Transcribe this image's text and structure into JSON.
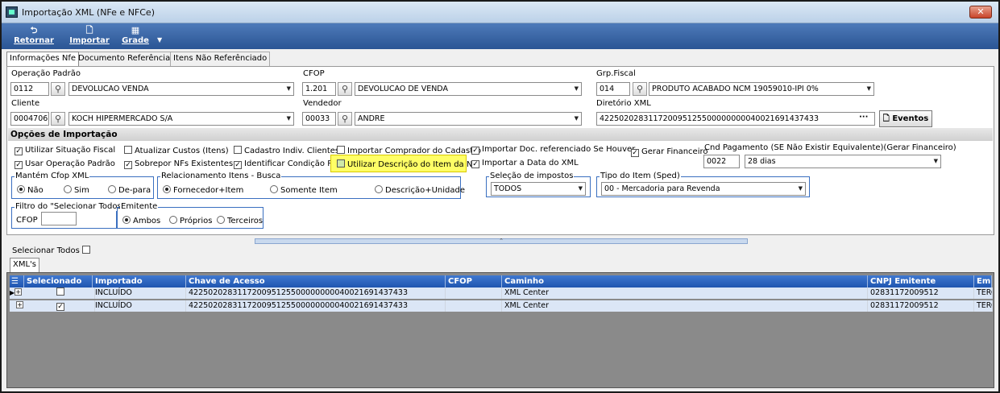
{
  "window": {
    "title": "Importação XML (NFe e NFCe)",
    "close": "✕"
  },
  "toolbar": {
    "retornar": "Retornar",
    "importar": "Importar",
    "grade": "Grade"
  },
  "tabs": [
    "Informações Nfe",
    "Documento Referênciado",
    "Itens Não Referênciado"
  ],
  "form": {
    "operacao_label": "Operação Padrão",
    "operacao_code": "0112",
    "operacao_desc": "DEVOLUCAO VENDA",
    "cfop_label": "CFOP",
    "cfop_code": "1.201",
    "cfop_desc": "DEVOLUCAO DE VENDA",
    "grp_label": "Grp.Fiscal",
    "grp_code": "014",
    "grp_desc": "PRODUTO ACABADO NCM 19059010-IPI 0%",
    "cliente_label": "Cliente",
    "cliente_code": "0004706",
    "cliente_desc": "KOCH HIPERMERCADO S/A",
    "vendedor_label": "Vendedor",
    "vendedor_code": "00033",
    "vendedor_desc": "ANDRE",
    "diretorio_label": "Diretório XML",
    "diretorio_value": "42250202831172009512550000000004002169143​7433",
    "diretorio_dots": "···",
    "eventos_button": "Eventos"
  },
  "opcoes": {
    "header": "Opções de Importação",
    "checks": [
      {
        "label": "Utilizar Situação Fiscal",
        "checked": true
      },
      {
        "label": "Usar Operação Padrão",
        "checked": true
      },
      {
        "label": "Atualizar Custos (Itens)",
        "checked": false
      },
      {
        "label": "Sobrepor NFs Existentes",
        "checked": true
      },
      {
        "label": "Cadastro Indiv. Clientes",
        "checked": false
      },
      {
        "label": "Identificar Condição Pgto",
        "checked": true
      },
      {
        "label": "Importar Comprador do Cadastro",
        "checked": false
      },
      {
        "label": "Utilizar Descrição do Item da NF",
        "checked": false
      },
      {
        "label": "Importar Doc. referenciado Se Houver",
        "checked": true
      },
      {
        "label": "Importar a Data do XML",
        "checked": true
      },
      {
        "label": "Gerar Financeiro",
        "checked": true
      }
    ],
    "cnd_label": "Cnd Pagamento (SE Não Existir Equivalente)(Gerar Financeiro)",
    "cnd_code": "0022",
    "cnd_desc": "28 dias"
  },
  "mantem_cfop": {
    "title": "Mantém Cfop XML",
    "options": [
      "Não",
      "Sim",
      "De-para"
    ],
    "selected": 0
  },
  "relacionamento": {
    "title": "Relacionamento Itens - Busca",
    "options": [
      "Fornecedor+Item",
      "Somente Item",
      "Descrição+Unidade"
    ],
    "selected": 0
  },
  "selecao_impostos": {
    "title": "Seleção de impostos",
    "value": "TODOS"
  },
  "tipo_item": {
    "title": "Tipo do Item (Sped)",
    "value": "00 - Mercadoria para Revenda"
  },
  "filtro": {
    "title": "Filtro do \"Selecionar Todos\"",
    "cfop_label": "CFOP",
    "cfop_value": ""
  },
  "emitente": {
    "title": "Emitente",
    "options": [
      "Ambos",
      "Próprios",
      "Terceiros"
    ],
    "selected": 0
  },
  "selecionar_todos": "Selecionar Todos",
  "xml_tab": "XML's",
  "grid": {
    "columns": [
      "Selecionado",
      "Importado",
      "Chave de Acesso",
      "CFOP",
      "Caminho",
      "CNPJ Emitente",
      "Emit"
    ],
    "rows": [
      {
        "selecionado": false,
        "importado": "INCLUÍDO",
        "chave": "42250202831172009512550000000004002169143​7433",
        "cfop": "",
        "caminho": "XML Center",
        "cnpj": "02831172009512",
        "emit": "TERC"
      },
      {
        "selecionado": true,
        "importado": "INCLUÍDO",
        "chave": "42250202831172009512550000000004002169143​7433",
        "cfop": "",
        "caminho": "XML Center",
        "cnpj": "02831172009512",
        "emit": "TERC"
      }
    ]
  },
  "colors": {
    "toolbar": "#2a5594",
    "grid_header": "#1f55b0",
    "highlight": "#ffff66"
  }
}
